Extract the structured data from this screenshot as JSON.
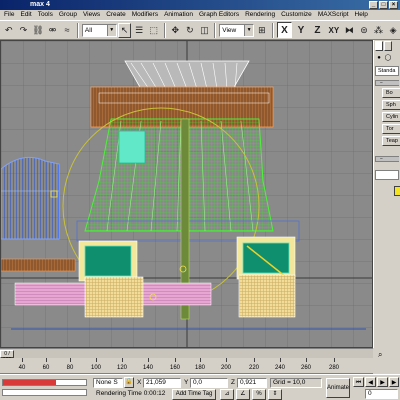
{
  "window": {
    "title": "max 4"
  },
  "menu": [
    "File",
    "Edit",
    "Tools",
    "Group",
    "Views",
    "Create",
    "Modifiers",
    "Animation",
    "Graph Editors",
    "Rendering",
    "Customize",
    "MAXScript",
    "Help"
  ],
  "toolbar": {
    "selection_filter": "All",
    "reference_coord": "View",
    "axis_x": "X",
    "axis_y": "Y",
    "axis_z": "Z",
    "axis_xy": "XY"
  },
  "command_panel": {
    "dropdown": "Standa",
    "buttons": [
      "Bo",
      "Sph",
      "Cylin",
      "Tor",
      "Teap"
    ]
  },
  "timeline": {
    "slider": "0 / 100",
    "ticks": [
      "40",
      "60",
      "80",
      "100",
      "120",
      "140",
      "160",
      "180",
      "200",
      "220",
      "240",
      "260",
      "280"
    ]
  },
  "status": {
    "selection": "None S",
    "x_label": "X",
    "x_value": "21,059",
    "y_label": "Y",
    "y_value": "0,0",
    "z_label": "Z",
    "z_value": "0,921",
    "grid": "Grid = 10,0",
    "rendering_time": "Rendering Time  0:00:12",
    "add_time_tag": "Add Time Tag",
    "animate": "Animate",
    "frame": "0"
  }
}
